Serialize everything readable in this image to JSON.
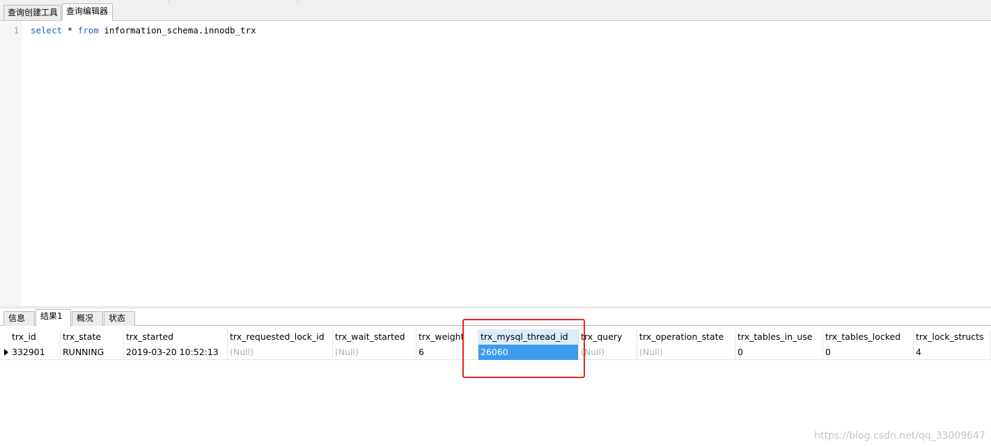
{
  "top_tabs": [
    "查询创建工具",
    "查询编辑器"
  ],
  "editor": {
    "line_number": "1",
    "keyword_select": "select",
    "star": " * ",
    "keyword_from": "from",
    "rest": " information_schema.innodb_trx"
  },
  "bottom_tabs": [
    "信息",
    "结果1",
    "概况",
    "状态"
  ],
  "columns": [
    "trx_id",
    "trx_state",
    "trx_started",
    "trx_requested_lock_id",
    "trx_wait_started",
    "trx_weight",
    "trx_mysql_thread_id",
    "trx_query",
    "trx_operation_state",
    "trx_tables_in_use",
    "trx_tables_locked",
    "trx_lock_structs"
  ],
  "rows": [
    [
      "332901",
      "RUNNING",
      "2019-03-20 10:52:13",
      "(Null)",
      "(Null)",
      "6",
      "26060",
      "(Null)",
      "(Null)",
      "0",
      "0",
      "4"
    ]
  ],
  "highlight_color": "#e8231d",
  "selection_color": "#3d9bf0",
  "watermark": "https://blog.csdn.net/qq_33009647"
}
